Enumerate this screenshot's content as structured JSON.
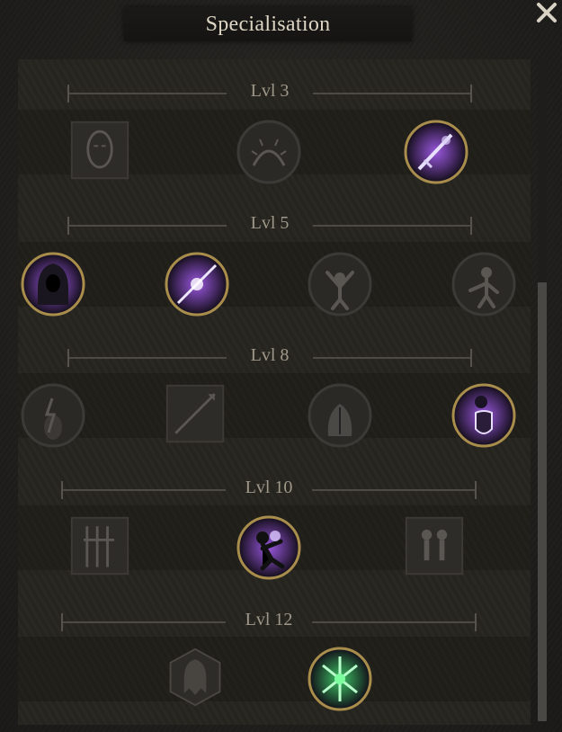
{
  "header": {
    "title": "Specialisation"
  },
  "close": {
    "icon": "close-icon"
  },
  "levels": [
    {
      "label": "Lvl 3",
      "skills": [
        {
          "icon": "mask-icon",
          "shape": "square",
          "state": "locked"
        },
        {
          "icon": "thorn-bush-icon",
          "shape": "circle",
          "state": "locked"
        },
        {
          "icon": "sword-slash-icon",
          "shape": "circle",
          "state": "active"
        }
      ]
    },
    {
      "label": "Lvl 5",
      "skills": [
        {
          "icon": "hooded-figure-icon",
          "shape": "circle",
          "state": "active"
        },
        {
          "icon": "crossed-blades-icon",
          "shape": "circle",
          "state": "active"
        },
        {
          "icon": "raised-arms-icon",
          "shape": "circle",
          "state": "locked"
        },
        {
          "icon": "fighter-stance-icon",
          "shape": "circle",
          "state": "locked"
        }
      ]
    },
    {
      "label": "Lvl 8",
      "skills": [
        {
          "icon": "lightning-figure-icon",
          "shape": "circle",
          "state": "locked"
        },
        {
          "icon": "spear-icon",
          "shape": "square",
          "state": "locked"
        },
        {
          "icon": "muscled-back-icon",
          "shape": "circle",
          "state": "locked"
        },
        {
          "icon": "shield-knight-icon",
          "shape": "circle",
          "state": "active"
        }
      ]
    },
    {
      "label": "Lvl 10",
      "skills": [
        {
          "icon": "weapon-rack-icon",
          "shape": "square",
          "state": "locked"
        },
        {
          "icon": "charging-warrior-icon",
          "shape": "circle",
          "state": "active"
        },
        {
          "icon": "duelists-icon",
          "shape": "square",
          "state": "locked"
        }
      ]
    },
    {
      "label": "Lvl 12",
      "skills": [
        {
          "icon": "ghost-hexagon-icon",
          "shape": "hexagon",
          "state": "locked"
        },
        {
          "icon": "green-blades-icon",
          "shape": "circle",
          "state": "selected"
        }
      ]
    }
  ],
  "colors": {
    "active_glow": "#a45cf0",
    "selected_glow": "#3fd06a",
    "ring_gold": "#a88d4c",
    "locked_ring": "#3c3a36"
  }
}
